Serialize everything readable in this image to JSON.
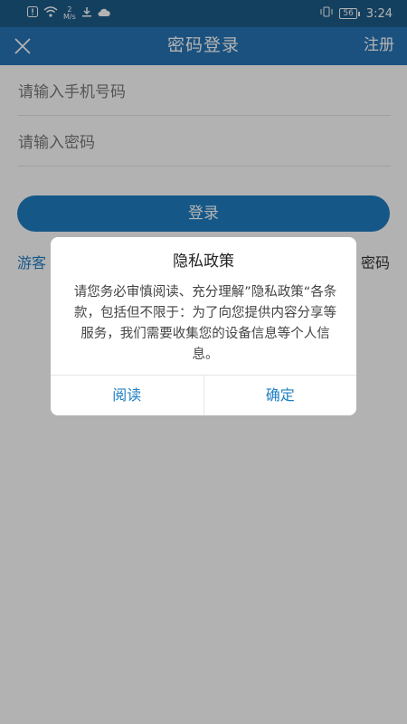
{
  "status_bar": {
    "speed_value": "2",
    "speed_unit": "M/s",
    "battery": "56",
    "time": "3:24",
    "icons": [
      "alert-icon",
      "wifi-icon",
      "download-icon",
      "cloud-icon",
      "vibrate-icon"
    ]
  },
  "nav": {
    "close_icon": "close-icon",
    "title": "密码登录",
    "register": "注册"
  },
  "form": {
    "phone_placeholder": "请输入手机号码",
    "password_placeholder": "请输入密码",
    "login_button": "登录",
    "guest_link": "游客",
    "forgot_link": "密码"
  },
  "dialog": {
    "title": "隐私政策",
    "body": "请您务必审慎阅读、充分理解”隐私政策“各条款，包括但不限于：为了向您提供内容分享等服务，我们需要收集您的设备信息等个人信息。",
    "read_button": "阅读",
    "confirm_button": "确定"
  },
  "colors": {
    "status_bar": "#1d5c8a",
    "nav_bar": "#2775b6",
    "accent": "#1f7fc3"
  }
}
